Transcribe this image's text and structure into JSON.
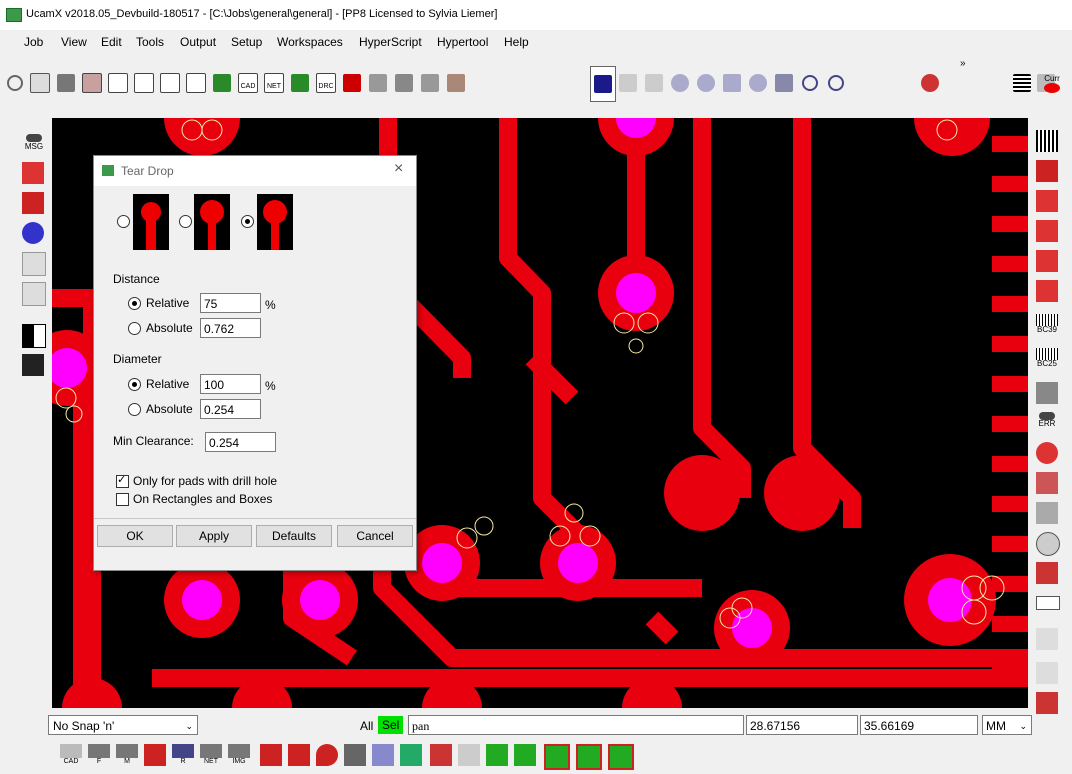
{
  "window": {
    "title": "UcamX v2018.05_Devbuild-180517 - [C:\\Jobs\\general\\general] - [PP8 Licensed to Sylvia Liemer]"
  },
  "menu": [
    "Job",
    "View",
    "Edit",
    "Tools",
    "Output",
    "Setup",
    "Workspaces",
    "HyperScript",
    "Hypertool",
    "Help"
  ],
  "toolbar": {
    "icons": [
      "power-icon",
      "open-job-icon",
      "save-icon",
      "grid-icon",
      "new-icon",
      "print-icon",
      "print-as-icon",
      "layer-icon",
      "compare-icon",
      "cad-import-icon",
      "net-import-icon",
      "pattern-icon",
      "drc-icon",
      "house-icon",
      "stamp-icon",
      "cut-icon",
      "paste-icon",
      "person-icon",
      "person-selected-icon",
      "person-outline-icon",
      "person-small-icon",
      "zoom-in-icon",
      "zoom-plus-icon",
      "zoom-window-icon",
      "zoom-out-icon",
      "refresh-icon",
      "undo-icon",
      "redo-icon",
      "eye-icon",
      "list-icon",
      "list-2-icon",
      "current-layer-icon"
    ],
    "cad_label": "CAD",
    "net_label": "NET",
    "drc_label": "DRC",
    "current_label": "Curr",
    "overflow": "»"
  },
  "left_toolbar": {
    "msg_label": "MSG",
    "icons": [
      "msg-icon",
      "tool-1-icon",
      "tool-2-icon",
      "tool-3-icon",
      "pointer-icon",
      "tool-5-icon",
      "half-square-icon",
      "mask-icon"
    ]
  },
  "right_toolbar": {
    "icons": [
      "pattern-grid-icon",
      "align-icon",
      "chip-1-icon",
      "chip-2-icon",
      "chip-3-icon",
      "chip-4-icon",
      "barcode-bc39-icon",
      "barcode-bc25-icon",
      "qr-icon",
      "err-icon",
      "dots-icon",
      "stack-icon",
      "drill-icon",
      "circle-icon",
      "pin-icon",
      "ruler-icon",
      "measure-icon",
      "arrow-icon",
      "pin-2-icon"
    ],
    "bc39_label": "BC39",
    "bc25_label": "BC25",
    "err_label": "ERR"
  },
  "dialog": {
    "title": "Tear Drop",
    "close_icon": "×",
    "shape_selected": 3,
    "distance": {
      "heading": "Distance",
      "relative_label": "Relative",
      "relative_value": "75",
      "relative_unit": "%",
      "absolute_label": "Absolute",
      "absolute_value": "0.762",
      "selected": "relative"
    },
    "diameter": {
      "heading": "Diameter",
      "relative_label": "Relative",
      "relative_value": "100",
      "relative_unit": "%",
      "absolute_label": "Absolute",
      "absolute_value": "0.254",
      "selected": "relative"
    },
    "min_clearance_label": "Min Clearance:",
    "min_clearance_value": "0.254",
    "only_drill_label": "Only for pads with drill hole",
    "only_drill_checked": true,
    "rect_boxes_label": "On Rectangles and Boxes",
    "rect_boxes_checked": false,
    "buttons": {
      "ok": "OK",
      "apply": "Apply",
      "defaults": "Defaults",
      "cancel": "Cancel"
    }
  },
  "statusbar": {
    "snap": "No Snap 'n'",
    "all_label": "All",
    "sel_label": "Sel",
    "command": "pan",
    "x_coord": "28.67156",
    "y_coord": "35.66169",
    "units": "MM"
  },
  "bottom_toolbar": {
    "cad_label": "CAD",
    "f_label": "F",
    "m_label": "M",
    "r_label": "R",
    "net_label": "NET",
    "img_label": "IMG",
    "icons": [
      "cad-icon",
      "f-icon",
      "m-icon",
      "r-icon",
      "r2-icon",
      "net-icon",
      "img-icon",
      "pads-icon",
      "pins-icon",
      "drop-icon",
      "camera-icon",
      "hand-icon",
      "board-icon",
      "drill-icon",
      "text-icon",
      "green-board-1-icon",
      "green-board-2-icon",
      "green-board-3-icon",
      "green-board-4-icon",
      "green-board-5-icon"
    ]
  },
  "colors": {
    "copper": "#e8000e",
    "pad_center": "#ff00ff",
    "background": "#000000",
    "teardrop_outline": "#f5e9a0"
  }
}
